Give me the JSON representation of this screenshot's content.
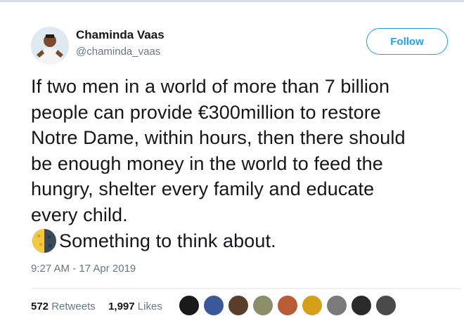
{
  "tweet": {
    "author": {
      "display_name": "Chaminda Vaas",
      "handle": "@chaminda_vaas"
    },
    "follow_label": "Follow",
    "text_lines": [
      "If two men in a world of more than 7 billion",
      "people can provide €300million to restore",
      "Notre Dame, within hours, then there should",
      "be enough money in the world to feed the",
      "hungry, shelter every family and educate",
      "every child."
    ],
    "last_line": "Something to think about.",
    "last_line_icon": "last-quarter-moon-icon",
    "timestamp": "9:27 AM - 17 Apr 2019",
    "retweets": {
      "count": "572",
      "label": "Retweets"
    },
    "likes": {
      "count": "1,997",
      "label": "Likes"
    },
    "liker_avatar_colors": [
      "#1a1a1a",
      "#3b5998",
      "#5a3e2b",
      "#8a8f6a",
      "#b85c38",
      "#d4a017",
      "#7a7a7a",
      "#2a2a2a",
      "#4a4a4a"
    ]
  },
  "colors": {
    "accent": "#1da1f2",
    "text": "#14171a",
    "muted": "#657786"
  }
}
